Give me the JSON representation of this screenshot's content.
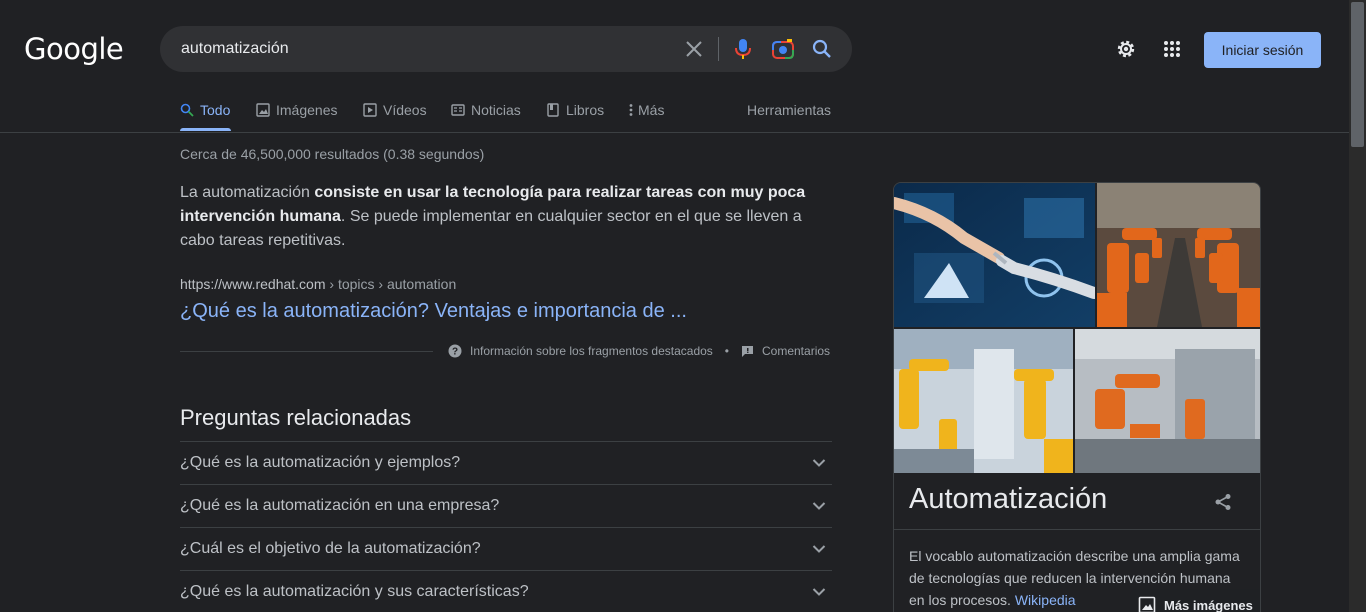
{
  "logo": "Google",
  "search": {
    "query": "automatización"
  },
  "header": {
    "signin_label": "Iniciar sesión"
  },
  "tabs": [
    {
      "label": "Todo"
    },
    {
      "label": "Imágenes"
    },
    {
      "label": "Vídeos"
    },
    {
      "label": "Noticias"
    },
    {
      "label": "Libros"
    },
    {
      "label": "Más"
    }
  ],
  "tools_label": "Herramientas",
  "result_stats": "Cerca de 46,500,000 resultados (0.38 segundos)",
  "featured": {
    "snippet_pre": "La automatización ",
    "snippet_bold": "consiste en usar la tecnología para realizar tareas con muy poca intervención humana",
    "snippet_post": ". Se puede implementar en cualquier sector en el que se lleven a cabo tareas repetitivas.",
    "cite_domain": "https://www.redhat.com",
    "cite_path": " › topics › automation",
    "title": "¿Qué es la automatización? Ventajas e importancia de ...",
    "info_label": "Información sobre los fragmentos destacados",
    "bullet": "•",
    "feedback_label": "Comentarios"
  },
  "paa": {
    "title": "Preguntas relacionadas",
    "items": [
      {
        "q": "¿Qué es la automatización y ejemplos?"
      },
      {
        "q": "¿Qué es la automatización en una empresa?"
      },
      {
        "q": "¿Cuál es el objetivo de la automatización?"
      },
      {
        "q": "¿Qué es la automatización y sus características?"
      }
    ]
  },
  "knowledge_panel": {
    "more_images_label": "Más imágenes",
    "title": "Automatización",
    "description": "El vocablo automatización describe una amplia gama de tecnologías que reducen la intervención humana en los procesos. ",
    "source_link": "Wikipedia"
  },
  "colors": {
    "background": "#202124",
    "link": "#8ab4f8",
    "text": "#bdc1c6",
    "muted": "#9aa0a6"
  }
}
